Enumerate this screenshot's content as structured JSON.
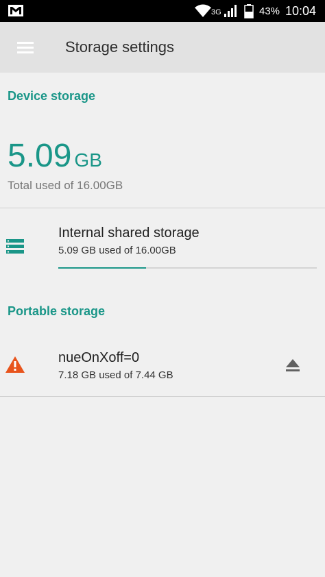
{
  "status_bar": {
    "network": "3G",
    "battery": "43%",
    "time": "10:04",
    "icons": [
      "gmail-icon",
      "wifi-icon",
      "signal-icon",
      "battery-icon"
    ]
  },
  "app_bar": {
    "title": "Storage settings",
    "menu_icon": "hamburger-menu-icon"
  },
  "device_storage": {
    "header": "Device storage",
    "used_value": "5.09",
    "used_unit": "GB",
    "total_label": "Total used of 16.00GB",
    "internal": {
      "title": "Internal shared storage",
      "subtitle": "5.09 GB used of 16.00GB",
      "icon": "storage-list-icon",
      "used_fraction": 0.34
    }
  },
  "portable_storage": {
    "header": "Portable storage",
    "device": {
      "title": "nueOnXoff=0",
      "subtitle": "7.18 GB used of 7.44 GB",
      "icon": "warning-icon",
      "action_icon": "eject-icon"
    }
  },
  "colors": {
    "accent": "#1a9688",
    "warning": "#e8541c",
    "app_bar": "#e2e2e2",
    "background": "#f0f0f0"
  }
}
